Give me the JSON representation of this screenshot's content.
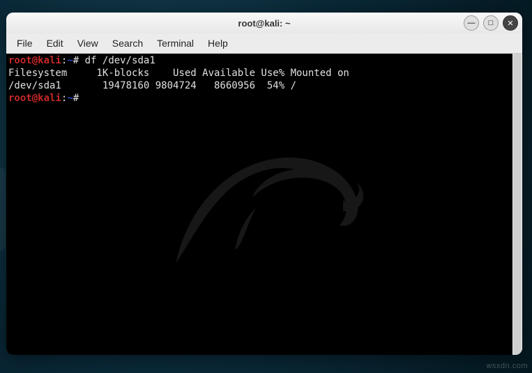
{
  "window": {
    "title": "root@kali: ~"
  },
  "menubar": {
    "items": [
      "File",
      "Edit",
      "View",
      "Search",
      "Terminal",
      "Help"
    ]
  },
  "prompt": {
    "user": "root",
    "at": "@",
    "host": "kali",
    "sep": ":",
    "path": "~",
    "end": "#"
  },
  "session": [
    {
      "type": "cmd",
      "command": "df /dev/sda1"
    },
    {
      "type": "out",
      "text": "Filesystem     1K-blocks    Used Available Use% Mounted on"
    },
    {
      "type": "out",
      "text": "/dev/sda1       19478160 9804724   8660956  54% /"
    },
    {
      "type": "cmd",
      "command": ""
    }
  ],
  "controls": {
    "min": "—",
    "max": "□",
    "close": "✕"
  },
  "watermark": "wsxdn.com"
}
